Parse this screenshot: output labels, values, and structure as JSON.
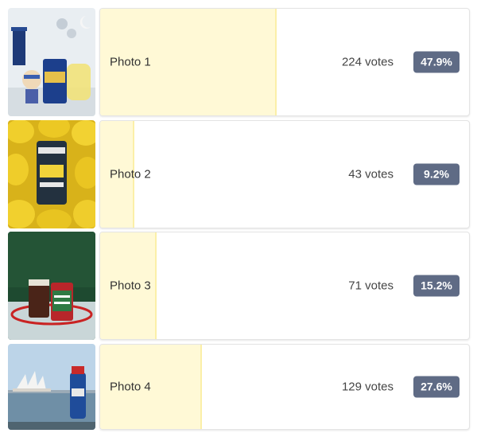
{
  "options": [
    {
      "label": "Photo 1",
      "votes": "224 votes",
      "percent": "47.9%",
      "share": 0.479
    },
    {
      "label": "Photo 2",
      "votes": "43 votes",
      "percent": "9.2%",
      "share": 0.092
    },
    {
      "label": "Photo 3",
      "votes": "71 votes",
      "percent": "15.2%",
      "share": 0.152
    },
    {
      "label": "Photo 4",
      "votes": "129 votes",
      "percent": "27.6%",
      "share": 0.276
    }
  ],
  "colors": {
    "bar_fill": "#fff9d6",
    "bar_edge": "#fbefa8",
    "badge": "#5f6b85"
  },
  "thumbnails": [
    "photo-space-can-thumbnail",
    "photo-lemon-can-thumbnail",
    "photo-christmas-can-thumbnail",
    "photo-opera-house-can-thumbnail"
  ]
}
